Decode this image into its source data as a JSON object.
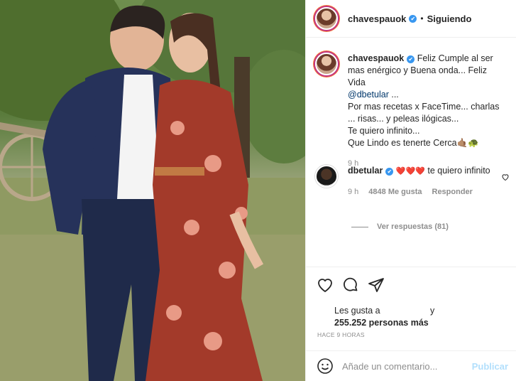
{
  "post": {
    "username": "chavespauok",
    "verified_mark": "✔",
    "separator": "•",
    "follow_status": "Siguiendo"
  },
  "caption": {
    "username": "chavespauok",
    "line1": "Feliz Cumple al ser mas enérgico y Buena onda... Feliz Vida",
    "mention": "@dbetular",
    "line1_tail": " ...",
    "line2": "Por mas recetas x FaceTime... charlas ... risas... y peleas ilógicas...",
    "line3": "Te quiero infinito...",
    "line4": "Que Lindo es tenerte Cerca🤙🏽🐢",
    "time": "9 h"
  },
  "reply": {
    "username": "dbetular",
    "text_hearts": "❤️❤️❤️",
    "text": "te quiero infinito",
    "time": "9 h",
    "likes": "4848 Me gusta",
    "reply_label": "Responder",
    "view_replies": "Ver respuestas (81)"
  },
  "likes": {
    "prefix": "Les gusta a",
    "and": "y",
    "count": "255.252 personas más"
  },
  "timestamp": "HACE 9 HORAS",
  "add_comment": {
    "placeholder": "Añade un comentario...",
    "post_label": "Publicar"
  },
  "icons": [
    "heart-icon",
    "comment-icon",
    "share-icon",
    "emoji-icon",
    "verified-icon"
  ],
  "colors": {
    "verified": "#3897f0",
    "publish_disabled": "#b2dffc",
    "mention": "#00376b",
    "heart": "#ed4956"
  }
}
